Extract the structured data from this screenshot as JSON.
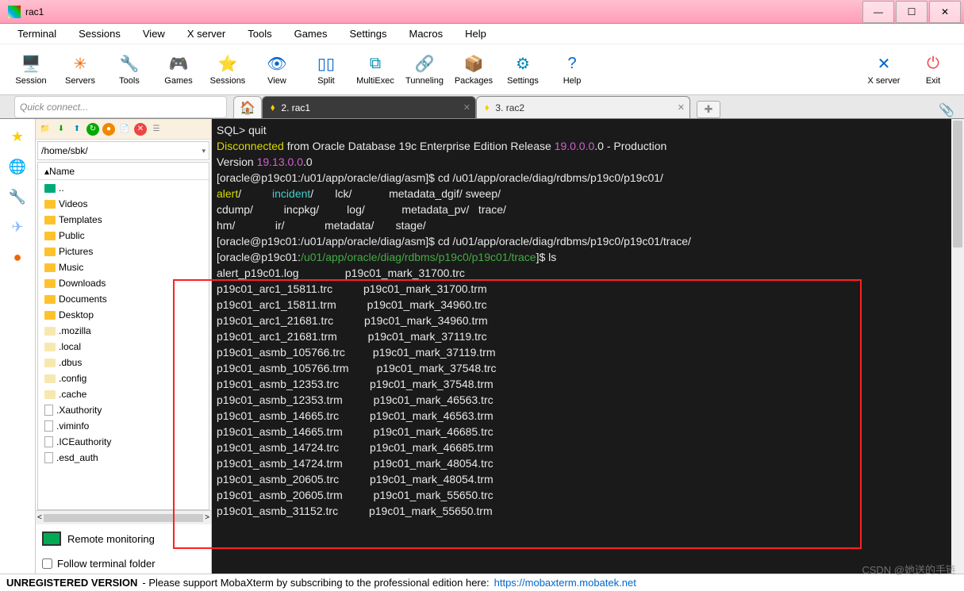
{
  "window": {
    "title": "rac1"
  },
  "menu": [
    "Terminal",
    "Sessions",
    "View",
    "X server",
    "Tools",
    "Games",
    "Settings",
    "Macros",
    "Help"
  ],
  "toolbar": [
    {
      "label": "Session",
      "icon": "🖥️",
      "c": "#06c"
    },
    {
      "label": "Servers",
      "icon": "✳",
      "c": "#e60"
    },
    {
      "label": "Tools",
      "icon": "🔧",
      "c": "#c80"
    },
    {
      "label": "Games",
      "icon": "🎮",
      "c": "#888"
    },
    {
      "label": "Sessions",
      "icon": "⭐",
      "c": "#fc0"
    },
    {
      "label": "View",
      "icon": "👁",
      "c": "#06c"
    },
    {
      "label": "Split",
      "icon": "▯▯",
      "c": "#06c"
    },
    {
      "label": "MultiExec",
      "icon": "⧉",
      "c": "#08a"
    },
    {
      "label": "Tunneling",
      "icon": "🔗",
      "c": "#07c"
    },
    {
      "label": "Packages",
      "icon": "📦",
      "c": "#a85"
    },
    {
      "label": "Settings",
      "icon": "⚙",
      "c": "#08b"
    },
    {
      "label": "Help",
      "icon": "?",
      "c": "#06c"
    }
  ],
  "toolbar_right": [
    {
      "label": "X server",
      "icon": "✕",
      "c": "#06c"
    },
    {
      "label": "Exit",
      "icon": "⏻",
      "c": "#e44"
    }
  ],
  "quick_connect_placeholder": "Quick connect...",
  "tabs": [
    {
      "label": "2. rac1",
      "active": true
    },
    {
      "label": "3. rac2",
      "active": false
    }
  ],
  "sidebar": {
    "path": "/home/sbk/",
    "header": "Name",
    "items": [
      {
        "name": "..",
        "type": "up"
      },
      {
        "name": "Videos",
        "type": "folder"
      },
      {
        "name": "Templates",
        "type": "folder"
      },
      {
        "name": "Public",
        "type": "folder"
      },
      {
        "name": "Pictures",
        "type": "folder"
      },
      {
        "name": "Music",
        "type": "folder"
      },
      {
        "name": "Downloads",
        "type": "folder"
      },
      {
        "name": "Documents",
        "type": "folder"
      },
      {
        "name": "Desktop",
        "type": "folder"
      },
      {
        "name": ".mozilla",
        "type": "hfolder"
      },
      {
        "name": ".local",
        "type": "hfolder"
      },
      {
        "name": ".dbus",
        "type": "hfolder"
      },
      {
        "name": ".config",
        "type": "hfolder"
      },
      {
        "name": ".cache",
        "type": "hfolder"
      },
      {
        "name": ".Xauthority",
        "type": "hfile"
      },
      {
        "name": ".viminfo",
        "type": "hfile"
      },
      {
        "name": ".ICEauthority",
        "type": "hfile"
      },
      {
        "name": ".esd_auth",
        "type": "hfile"
      }
    ],
    "remote_monitoring": "Remote monitoring",
    "follow_terminal": "Follow terminal folder"
  },
  "terminal": {
    "lines": [
      [
        [
          "w",
          ""
        ]
      ],
      [
        [
          "w",
          "SQL> quit"
        ]
      ],
      [
        [
          "y",
          "Disconnected"
        ],
        [
          "w",
          " from Oracle Database 19c Enterprise Edition Release "
        ],
        [
          "m",
          "19.0.0.0"
        ],
        [
          "w",
          ".0 - Production"
        ]
      ],
      [
        [
          "w",
          "Version "
        ],
        [
          "m",
          "19.13.0.0"
        ],
        [
          "w",
          ".0"
        ]
      ],
      [
        [
          "w",
          "[oracle@p19c01:/u01/app/oracle/diag/asm]$ cd /u01/app/oracle/diag/rdbms/p19c0/p19c01/"
        ]
      ],
      [
        [
          "y",
          "alert"
        ],
        [
          "w",
          "/          "
        ],
        [
          "c",
          "incident"
        ],
        [
          "w",
          "/       lck/            metadata_dgif/ sweep/"
        ]
      ],
      [
        [
          "w",
          "cdump/          incpkg/         log/            metadata_pv/   trace/"
        ]
      ],
      [
        [
          "w",
          "hm/             ir/             metadata/       stage/"
        ]
      ],
      [
        [
          "w",
          "[oracle@p19c01:/u01/app/oracle/diag/asm]$ cd /u01/app/oracle/diag/rdbms/p19c0/p19c01/trace/"
        ]
      ],
      [
        [
          "w",
          "[oracle@p19c01:"
        ],
        [
          "g",
          "/u01/app/oracle/diag/rdbms/p19c0/p19c01/trace"
        ],
        [
          "w",
          "]$ ls"
        ]
      ],
      [
        [
          "w",
          "alert_p19c01.log               p19c01_mark_31700.trc"
        ]
      ],
      [
        [
          "w",
          "p19c01_arc1_15811.trc          p19c01_mark_31700.trm"
        ]
      ],
      [
        [
          "w",
          "p19c01_arc1_15811.trm          p19c01_mark_34960.trc"
        ]
      ],
      [
        [
          "w",
          "p19c01_arc1_21681.trc          p19c01_mark_34960.trm"
        ]
      ],
      [
        [
          "w",
          "p19c01_arc1_21681.trm          p19c01_mark_37119.trc"
        ]
      ],
      [
        [
          "w",
          "p19c01_asmb_105766.trc         p19c01_mark_37119.trm"
        ]
      ],
      [
        [
          "w",
          "p19c01_asmb_105766.trm         p19c01_mark_37548.trc"
        ]
      ],
      [
        [
          "w",
          "p19c01_asmb_12353.trc          p19c01_mark_37548.trm"
        ]
      ],
      [
        [
          "w",
          "p19c01_asmb_12353.trm          p19c01_mark_46563.trc"
        ]
      ],
      [
        [
          "w",
          "p19c01_asmb_14665.trc          p19c01_mark_46563.trm"
        ]
      ],
      [
        [
          "w",
          "p19c01_asmb_14665.trm          p19c01_mark_46685.trc"
        ]
      ],
      [
        [
          "w",
          "p19c01_asmb_14724.trc          p19c01_mark_46685.trm"
        ]
      ],
      [
        [
          "w",
          "p19c01_asmb_14724.trm          p19c01_mark_48054.trc"
        ]
      ],
      [
        [
          "w",
          "p19c01_asmb_20605.trc          p19c01_mark_48054.trm"
        ]
      ],
      [
        [
          "w",
          "p19c01_asmb_20605.trm          p19c01_mark_55650.trc"
        ]
      ],
      [
        [
          "w",
          "p19c01_asmb_31152.trc          p19c01_mark_55650.trm"
        ]
      ]
    ]
  },
  "status": {
    "unreg": "UNREGISTERED VERSION",
    "msg": "-  Please support MobaXterm by subscribing to the professional edition here:",
    "url": "https://mobaxterm.mobatek.net"
  },
  "watermark": "CSDN @她送的手链"
}
